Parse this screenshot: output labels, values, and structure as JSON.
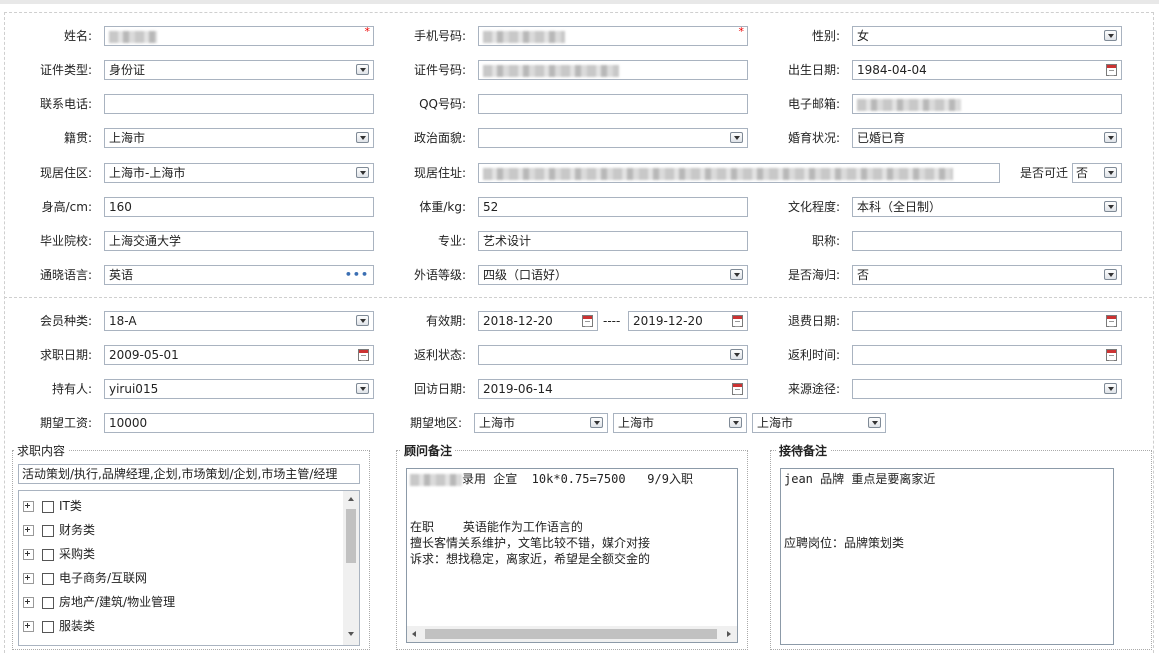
{
  "form": {
    "name": {
      "label": "姓名:"
    },
    "mobile": {
      "label": "手机号码:"
    },
    "gender": {
      "label": "性别:",
      "value": "女"
    },
    "id_type": {
      "label": "证件类型:",
      "value": "身份证"
    },
    "id_number": {
      "label": "证件号码:"
    },
    "birth_date": {
      "label": "出生日期:",
      "value": "1984-04-04"
    },
    "phone": {
      "label": "联系电话:",
      "value": ""
    },
    "qq": {
      "label": "QQ号码:",
      "value": ""
    },
    "email": {
      "label": "电子邮箱:"
    },
    "native_place": {
      "label": "籍贯:",
      "value": "上海市"
    },
    "political": {
      "label": "政治面貌:",
      "value": ""
    },
    "marital": {
      "label": "婚育状况:",
      "value": "已婚已育"
    },
    "residence_area": {
      "label": "现居住区:",
      "value": "上海市-上海市"
    },
    "address": {
      "label": "现居住址:"
    },
    "relocate": {
      "label": "是否可迁",
      "value": "否"
    },
    "height": {
      "label": "身高/cm:",
      "value": "160"
    },
    "weight": {
      "label": "体重/kg:",
      "value": "52"
    },
    "education": {
      "label": "文化程度:",
      "value": "本科（全日制）"
    },
    "school": {
      "label": "毕业院校:",
      "value": "上海交通大学"
    },
    "major": {
      "label": "专业:",
      "value": "艺术设计"
    },
    "title": {
      "label": "职称:",
      "value": ""
    },
    "language": {
      "label": "通晓语言:",
      "value": "英语",
      "more": "•••"
    },
    "foreign_level": {
      "label": "外语等级:",
      "value": "四级（口语好）"
    },
    "returnee": {
      "label": "是否海归:",
      "value": "否"
    },
    "member_type": {
      "label": "会员种类:",
      "value": "18-A"
    },
    "valid": {
      "label": "有效期:",
      "start": "2018-12-20",
      "separator": "----",
      "end": "2019-12-20"
    },
    "refund_date": {
      "label": "退费日期:",
      "value": ""
    },
    "apply_date": {
      "label": "求职日期:",
      "value": "2009-05-01"
    },
    "rebate_status": {
      "label": "返利状态:",
      "value": ""
    },
    "rebate_time": {
      "label": "返利时间:",
      "value": ""
    },
    "holder": {
      "label": "持有人:",
      "value": "yirui015"
    },
    "revisit_date": {
      "label": "回访日期:",
      "value": "2019-06-14"
    },
    "source": {
      "label": "来源途径:",
      "value": ""
    },
    "salary": {
      "label": "期望工资:",
      "value": "10000"
    },
    "region": {
      "label": "期望地区:",
      "values": [
        "上海市",
        "上海市",
        "上海市"
      ]
    }
  },
  "job_content": {
    "title": "求职内容",
    "summary": "活动策划/执行,品牌经理,企划,市场策划/企划,市场主管/经理",
    "categories": [
      "IT类",
      "财务类",
      "采购类",
      "电子商务/互联网",
      "房地产/建筑/物业管理",
      "服装类"
    ]
  },
  "consultant_notes": {
    "title": "顾问备注",
    "line1": "录用 企宣  10k*0.75=7500   9/9入职",
    "body": "在职    英语能作为工作语言的\n擅长客情关系维护，文笔比较不错，媒介对接\n诉求：想找稳定，离家近，希望是全额交金的"
  },
  "reception_notes": {
    "title": "接待备注",
    "text": "jean 品牌 重点是要离家近\n\n\n\n应聘岗位：品牌策划类"
  },
  "required_mark": "*"
}
